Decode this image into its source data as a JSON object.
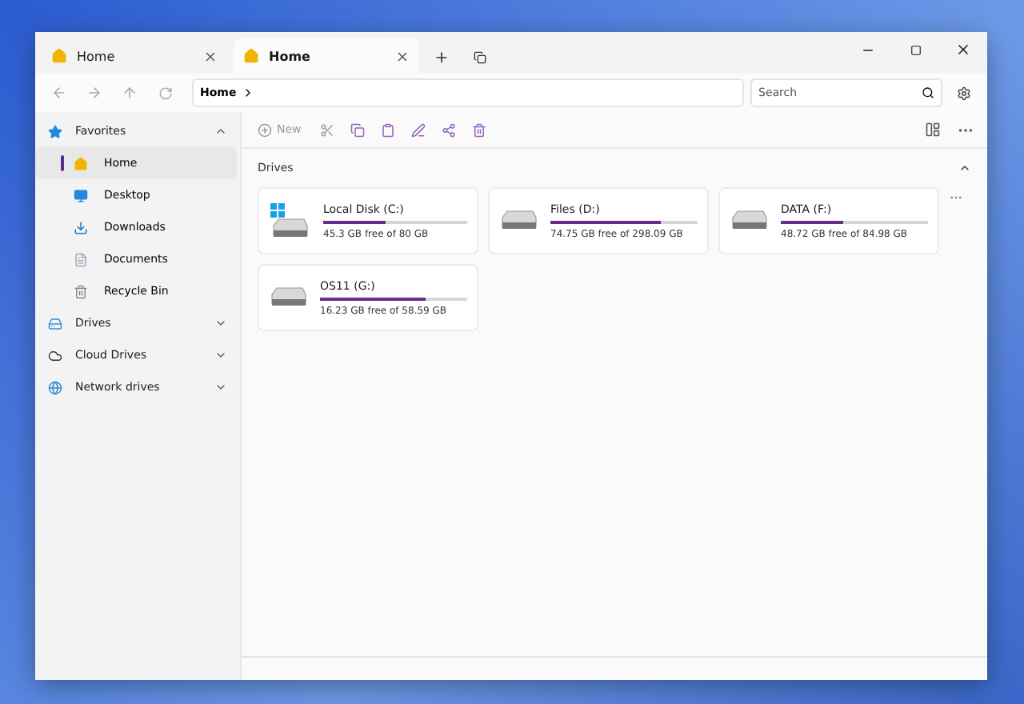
{
  "tabs": [
    {
      "label": "Home",
      "selected": false
    },
    {
      "label": "Home",
      "selected": true
    }
  ],
  "address": {
    "path": "Home"
  },
  "search": {
    "placeholder": "Search"
  },
  "toolbar": {
    "new": {
      "label": "New",
      "disabled": true
    }
  },
  "sidebar": [
    {
      "label": "Favorites",
      "expanded": true,
      "children": [
        {
          "label": "Home",
          "selected": true
        },
        {
          "label": "Desktop",
          "selected": false
        },
        {
          "label": "Downloads",
          "selected": false
        },
        {
          "label": "Documents",
          "selected": false
        },
        {
          "label": "Recycle Bin",
          "selected": false
        }
      ]
    },
    {
      "label": "Drives",
      "expanded": false
    },
    {
      "label": "Cloud Drives",
      "expanded": false
    },
    {
      "label": "Network drives",
      "expanded": false
    }
  ],
  "section": {
    "title": "Drives",
    "expanded": true
  },
  "drives": [
    {
      "name": "Local Disk (C:)",
      "kind": "system",
      "level": 0.43,
      "free": "45.3 GB free of 80 GB"
    },
    {
      "name": "Files (D:)",
      "kind": "disk",
      "level": 0.75,
      "free": "74.75 GB free of 298.09 GB"
    },
    {
      "name": "DATA (F:)",
      "kind": "disk",
      "level": 0.42,
      "free": "48.72 GB free of 84.98 GB"
    },
    {
      "name": "OS11 (G:)",
      "kind": "disk",
      "level": 0.72,
      "free": "16.23 GB free of 58.59 GB"
    }
  ]
}
